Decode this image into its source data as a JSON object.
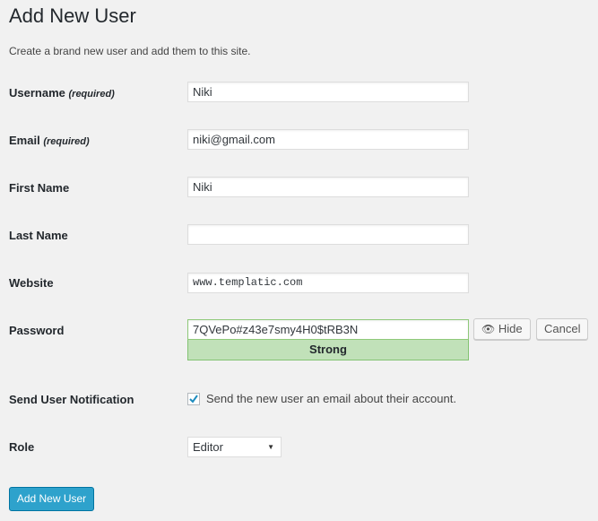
{
  "title": "Add New User",
  "description": "Create a brand new user and add them to this site.",
  "fields": {
    "username": {
      "label": "Username",
      "note": "(required)",
      "value": "Niki"
    },
    "email": {
      "label": "Email",
      "note": "(required)",
      "value": "niki@gmail.com"
    },
    "first_name": {
      "label": "First Name",
      "value": "Niki"
    },
    "last_name": {
      "label": "Last Name",
      "value": ""
    },
    "website": {
      "label": "Website",
      "value": "www.templatic.com"
    },
    "password": {
      "label": "Password",
      "value": "7QVePo#z43e7smy4H0$tRB3N",
      "strength": "Strong",
      "hide_label": "Hide",
      "cancel_label": "Cancel"
    },
    "notification": {
      "label": "Send User Notification",
      "checkbox_label": "Send the new user an email about their account.",
      "checked": true
    },
    "role": {
      "label": "Role",
      "value": "Editor"
    }
  },
  "submit_label": "Add New User",
  "colors": {
    "primary": "#2ea2cc",
    "strength_bg": "#c1e1b9"
  }
}
